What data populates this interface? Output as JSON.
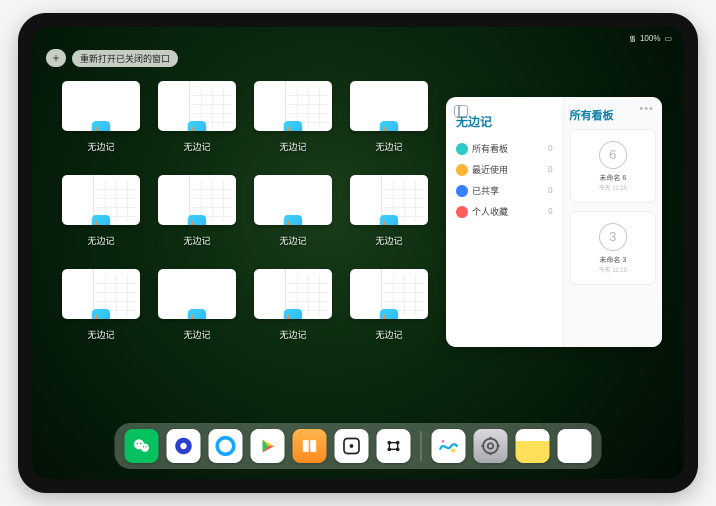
{
  "status": {
    "battery": "100%",
    "wifi": "▲"
  },
  "topbar": {
    "plus": "+",
    "reopen_label": "重新打开已关闭的窗口"
  },
  "windows": [
    {
      "label": "无边记",
      "split": false
    },
    {
      "label": "无边记",
      "split": true
    },
    {
      "label": "无边记",
      "split": true
    },
    {
      "label": "无边记",
      "split": false
    },
    {
      "label": "无边记",
      "split": true
    },
    {
      "label": "无边记",
      "split": true
    },
    {
      "label": "无边记",
      "split": false
    },
    {
      "label": "无边记",
      "split": true
    },
    {
      "label": "无边记",
      "split": true
    },
    {
      "label": "无边记",
      "split": false
    },
    {
      "label": "无边记",
      "split": true
    },
    {
      "label": "无边记",
      "split": true
    }
  ],
  "panel": {
    "app_name": "无边记",
    "right_title": "所有看板",
    "items": [
      {
        "label": "所有看板",
        "count": "0"
      },
      {
        "label": "最近使用",
        "count": "0"
      },
      {
        "label": "已共享",
        "count": "0"
      },
      {
        "label": "个人收藏",
        "count": "0"
      }
    ],
    "boards": [
      {
        "digit": "6",
        "name": "未命名 6",
        "time": "今天 11:25"
      },
      {
        "digit": "3",
        "name": "未命名 3",
        "time": "今天 11:25"
      }
    ]
  },
  "dock": {
    "recent_colors": [
      "#4fc4ff",
      "#9ad23e",
      "#ffb03a",
      "#3a7fff"
    ]
  }
}
